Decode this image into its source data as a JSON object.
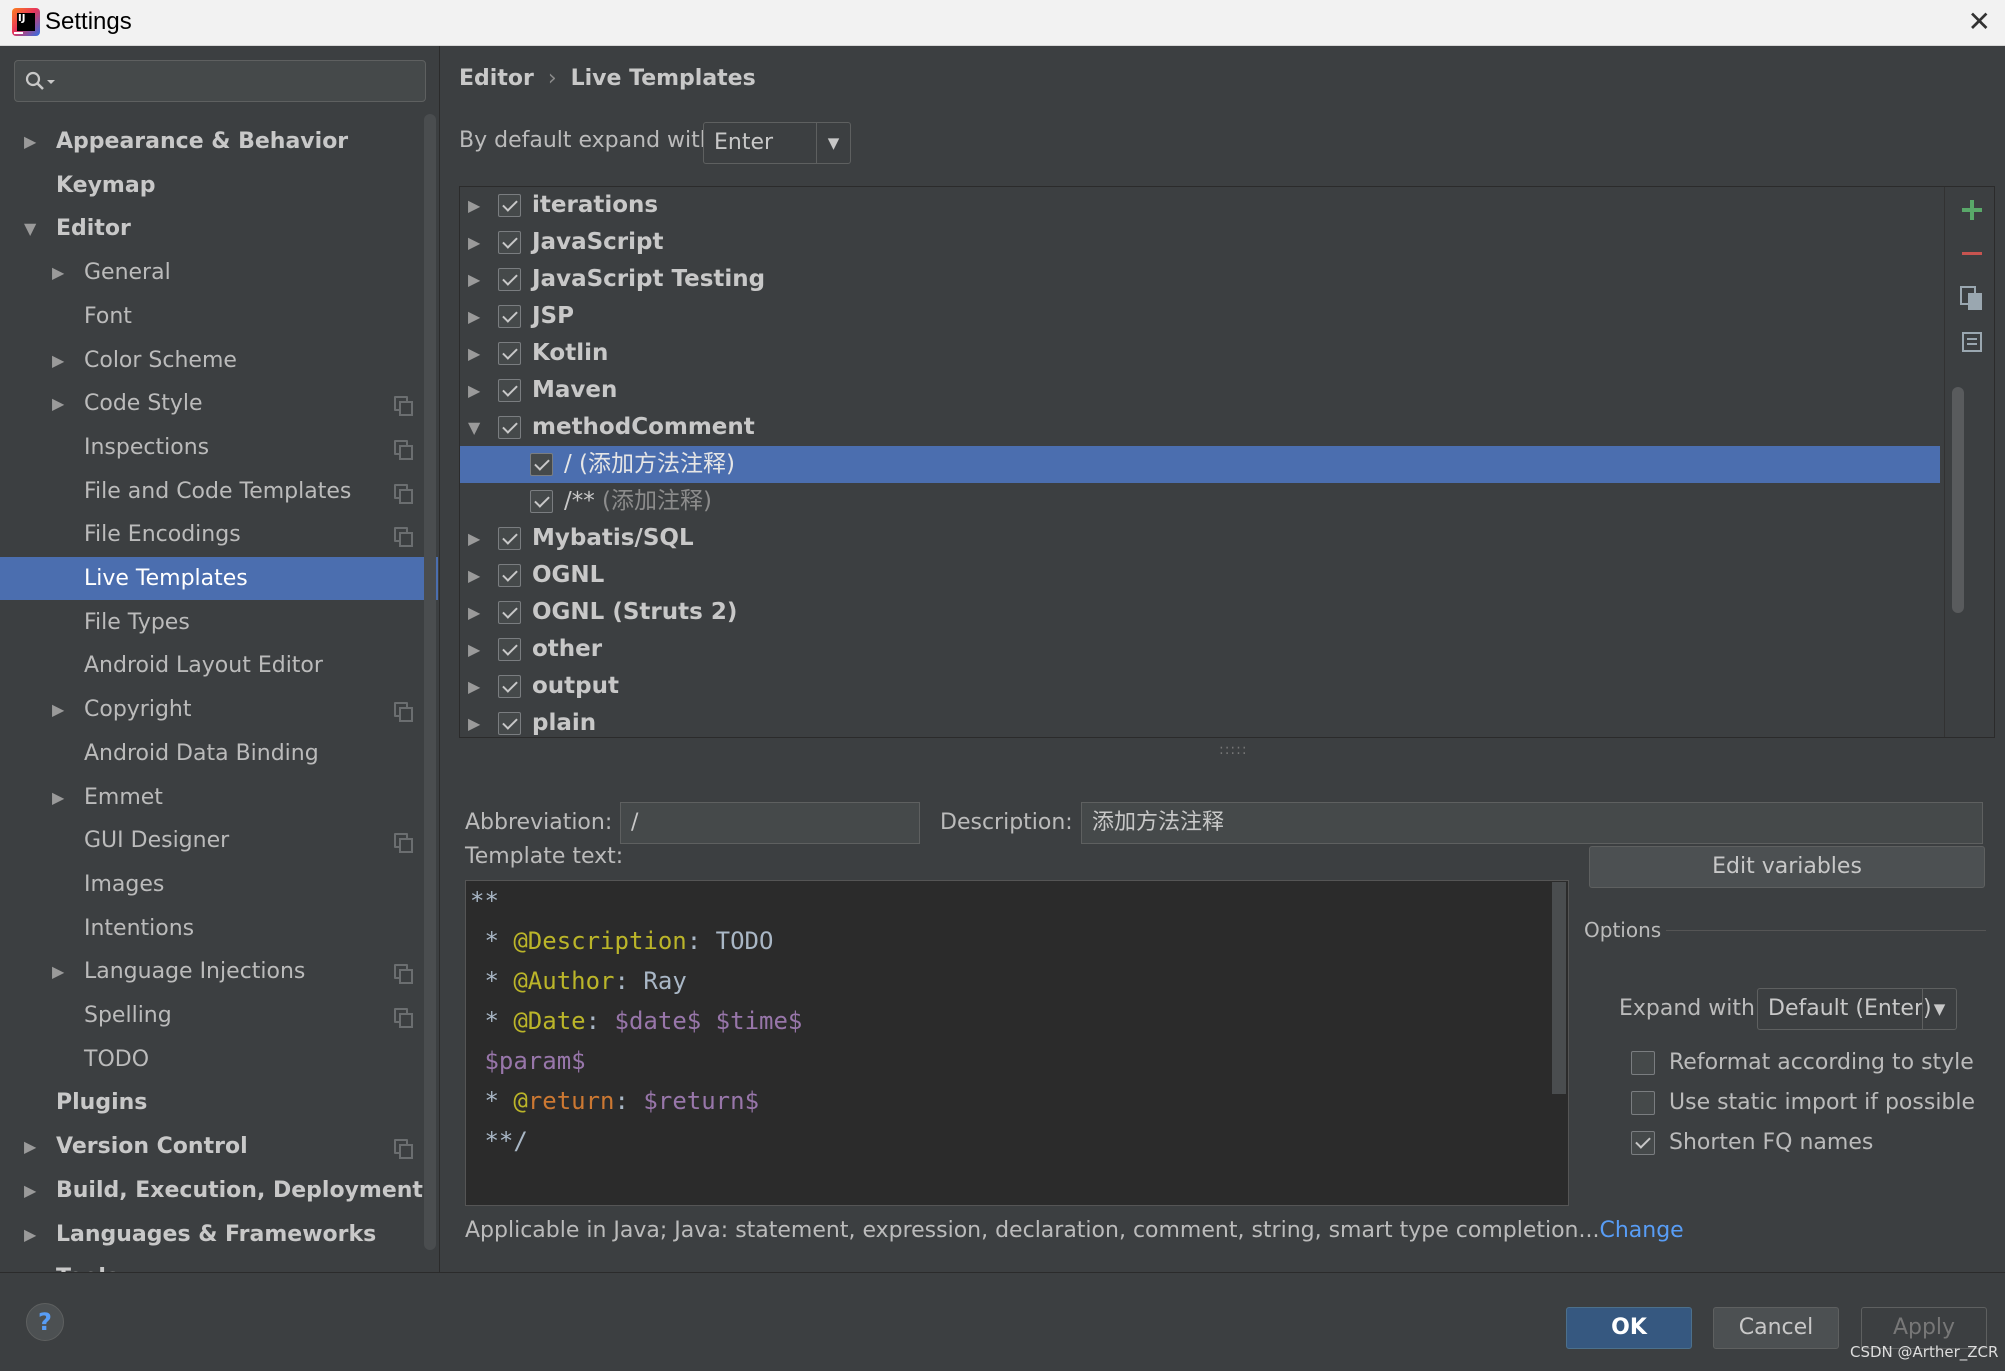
{
  "window": {
    "title": "Settings",
    "close": "✕"
  },
  "sidebar": {
    "items": [
      {
        "label": "Appearance & Behavior",
        "arrow": "▶",
        "level": 0,
        "bold": true
      },
      {
        "label": "Keymap",
        "arrow": "",
        "level": 0,
        "bold": true
      },
      {
        "label": "Editor",
        "arrow": "▼",
        "level": 0,
        "bold": true
      },
      {
        "label": "General",
        "arrow": "▶",
        "level": 1
      },
      {
        "label": "Font",
        "arrow": "",
        "level": 1
      },
      {
        "label": "Color Scheme",
        "arrow": "▶",
        "level": 1
      },
      {
        "label": "Code Style",
        "arrow": "▶",
        "level": 1,
        "copy_icon": true
      },
      {
        "label": "Inspections",
        "arrow": "",
        "level": 1,
        "copy_icon": true
      },
      {
        "label": "File and Code Templates",
        "arrow": "",
        "level": 1,
        "copy_icon": true
      },
      {
        "label": "File Encodings",
        "arrow": "",
        "level": 1,
        "copy_icon": true
      },
      {
        "label": "Live Templates",
        "arrow": "",
        "level": 1,
        "selected": true
      },
      {
        "label": "File Types",
        "arrow": "",
        "level": 1
      },
      {
        "label": "Android Layout Editor",
        "arrow": "",
        "level": 1
      },
      {
        "label": "Copyright",
        "arrow": "▶",
        "level": 1,
        "copy_icon": true
      },
      {
        "label": "Android Data Binding",
        "arrow": "",
        "level": 1
      },
      {
        "label": "Emmet",
        "arrow": "▶",
        "level": 1
      },
      {
        "label": "GUI Designer",
        "arrow": "",
        "level": 1,
        "copy_icon": true
      },
      {
        "label": "Images",
        "arrow": "",
        "level": 1
      },
      {
        "label": "Intentions",
        "arrow": "",
        "level": 1
      },
      {
        "label": "Language Injections",
        "arrow": "▶",
        "level": 1,
        "copy_icon": true
      },
      {
        "label": "Spelling",
        "arrow": "",
        "level": 1,
        "copy_icon": true
      },
      {
        "label": "TODO",
        "arrow": "",
        "level": 1
      },
      {
        "label": "Plugins",
        "arrow": "",
        "level": 0,
        "bold": true
      },
      {
        "label": "Version Control",
        "arrow": "▶",
        "level": 0,
        "bold": true,
        "copy_icon": true
      },
      {
        "label": "Build, Execution, Deployment",
        "arrow": "▶",
        "level": 0,
        "bold": true
      },
      {
        "label": "Languages & Frameworks",
        "arrow": "▶",
        "level": 0,
        "bold": true
      },
      {
        "label": "Tools",
        "arrow": "▶",
        "level": 0,
        "bold": true
      }
    ]
  },
  "breadcrumb": {
    "parent": "Editor",
    "separator": "›",
    "current": "Live Templates"
  },
  "expand_default": {
    "label": "By default expand with",
    "value": "Enter",
    "dropdown": "▼"
  },
  "templates": [
    {
      "label": "iterations",
      "checked": true,
      "arrow": "▶",
      "level": 0
    },
    {
      "label": "JavaScript",
      "checked": true,
      "arrow": "▶",
      "level": 0
    },
    {
      "label": "JavaScript Testing",
      "checked": true,
      "arrow": "▶",
      "level": 0
    },
    {
      "label": "JSP",
      "checked": true,
      "arrow": "▶",
      "level": 0
    },
    {
      "label": "Kotlin",
      "checked": true,
      "arrow": "▶",
      "level": 0
    },
    {
      "label": "Maven",
      "checked": true,
      "arrow": "▶",
      "level": 0
    },
    {
      "label": "methodComment",
      "checked": true,
      "arrow": "▼",
      "level": 0
    },
    {
      "label": "/",
      "desc": " (添加方法注释)",
      "checked": true,
      "arrow": "",
      "level": 1,
      "selected": true
    },
    {
      "label": "/**",
      "desc": " (添加注释)",
      "checked": true,
      "arrow": "",
      "level": 1
    },
    {
      "label": "Mybatis/SQL",
      "checked": true,
      "arrow": "▶",
      "level": 0
    },
    {
      "label": "OGNL",
      "checked": true,
      "arrow": "▶",
      "level": 0
    },
    {
      "label": "OGNL (Struts 2)",
      "checked": true,
      "arrow": "▶",
      "level": 0
    },
    {
      "label": "other",
      "checked": true,
      "arrow": "▶",
      "level": 0
    },
    {
      "label": "output",
      "checked": true,
      "arrow": "▶",
      "level": 0
    },
    {
      "label": "plain",
      "checked": true,
      "arrow": "▶",
      "level": 0
    }
  ],
  "toolbar": {
    "add_icon": "plus-icon",
    "remove_icon": "minus-icon",
    "copy_icon": "copy-icon",
    "restore_icon": "restore-icon"
  },
  "fields": {
    "abbreviation_label": "Abbreviation:",
    "abbreviation_value": "/",
    "description_label": "Description:",
    "description_value": "添加方法注释",
    "template_text_label": "Template text:"
  },
  "template_text": {
    "lines": [
      [
        {
          "t": "**",
          "c": ""
        }
      ],
      [
        {
          "t": " * ",
          "c": ""
        },
        {
          "t": "@Description",
          "c": "ann"
        },
        {
          "t": ": TODO",
          "c": ""
        }
      ],
      [
        {
          "t": " * ",
          "c": ""
        },
        {
          "t": "@Author",
          "c": "ann"
        },
        {
          "t": ": Ray",
          "c": ""
        }
      ],
      [
        {
          "t": " * ",
          "c": ""
        },
        {
          "t": "@Date",
          "c": "ann"
        },
        {
          "t": ": ",
          "c": ""
        },
        {
          "t": "$date$",
          "c": "var"
        },
        {
          "t": " ",
          "c": ""
        },
        {
          "t": "$time$",
          "c": "var"
        }
      ],
      [
        {
          "t": " ",
          "c": ""
        },
        {
          "t": "$param$",
          "c": "var"
        }
      ],
      [
        {
          "t": " * ",
          "c": ""
        },
        {
          "t": "@",
          "c": "ann"
        },
        {
          "t": "return",
          "c": "kw"
        },
        {
          "t": ": ",
          "c": ""
        },
        {
          "t": "$return$",
          "c": "var"
        }
      ],
      [
        {
          "t": " **/",
          "c": ""
        }
      ]
    ]
  },
  "edit_variables_label": "Edit variables",
  "options": {
    "title": "Options",
    "expand_label": "Expand with",
    "expand_value": "Default (Enter)",
    "dropdown": "▼",
    "reformat": {
      "label": "Reformat according to style",
      "checked": false
    },
    "static_import": {
      "label": "Use static import if possible",
      "checked": false
    },
    "shorten_fq": {
      "label": "Shorten FQ names",
      "checked": true
    }
  },
  "applicable": {
    "text": "Applicable in Java; Java: statement, expression, declaration, comment, string, smart type completion...",
    "link": "Change"
  },
  "footer": {
    "help": "?",
    "ok": "OK",
    "cancel": "Cancel",
    "apply": "Apply"
  },
  "watermark": "CSDN @Arther_ZCR",
  "colors": {
    "selection": "#4b6eaf",
    "background": "#3c3f41",
    "link": "#589df6",
    "ok_button": "#365880"
  }
}
